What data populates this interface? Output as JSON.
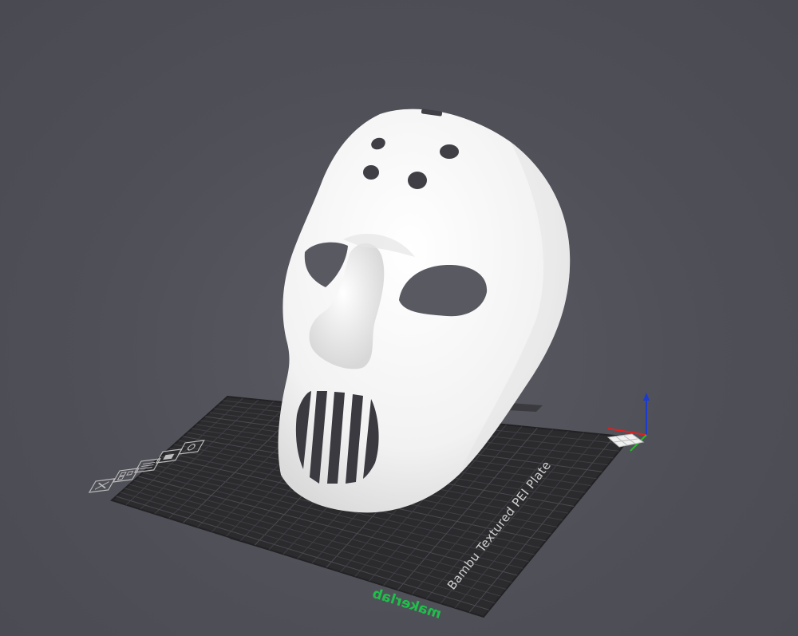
{
  "plate": {
    "name": "Bambu Textured PEI Plate",
    "brand": "makerlab",
    "color": "#2b2b2e",
    "grid_color": "#3f3f44"
  },
  "model": {
    "name": "hockey-mask",
    "color": "#f4f4f4"
  },
  "plate_toolbar": {
    "buttons": [
      {
        "name": "delete-plate-button",
        "icon": "close-icon"
      },
      {
        "name": "arrange-plate-button",
        "icon": "arrange-icon"
      },
      {
        "name": "orient-plate-button",
        "icon": "orient-icon"
      },
      {
        "name": "lock-plate-button",
        "icon": "lock-icon"
      },
      {
        "name": "plate-settings-button",
        "icon": "settings-icon"
      }
    ]
  },
  "axes": {
    "x_color": "#e02020",
    "y_color": "#20c020",
    "z_color": "#1a3ad0"
  }
}
